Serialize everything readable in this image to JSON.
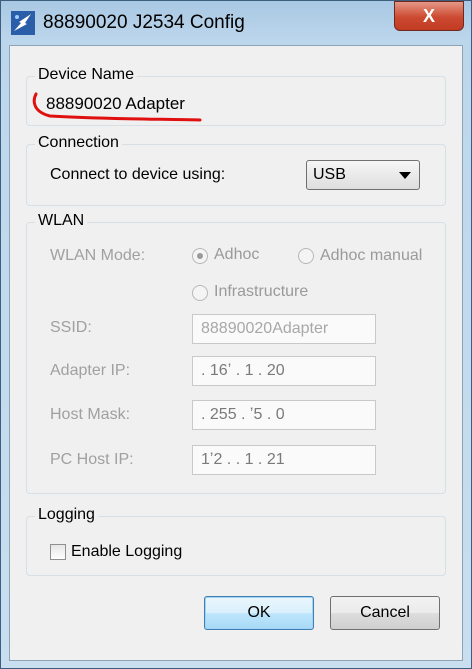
{
  "window": {
    "title": "88890020 J2534 Config",
    "close_symbol": "X"
  },
  "device_name": {
    "legend": "Device Name",
    "value": "88890020 Adapter"
  },
  "connection": {
    "legend": "Connection",
    "label": "Connect to device using:",
    "selected": "USB"
  },
  "wlan": {
    "legend": "WLAN",
    "mode_label": "WLAN Mode:",
    "modes": [
      "Adhoc",
      "Adhoc manual",
      "Infrastructure"
    ],
    "selected_mode": "Adhoc",
    "ssid_label": "SSID:",
    "ssid_value": "88890020Adapter",
    "adapter_ip_label": "Adapter IP:",
    "adapter_ip_value": "      .  16ʼ  .   1   .  20",
    "host_mask_label": "Host Mask:",
    "host_mask_value": "      .  255  .  ʼ5  .   0",
    "pc_host_ip_label": "PC Host IP:",
    "pc_host_ip_value": "1ʼ2  .        .   1   .  21"
  },
  "logging": {
    "legend": "Logging",
    "enable_label": "Enable Logging",
    "enabled": false
  },
  "buttons": {
    "ok": "OK",
    "cancel": "Cancel"
  },
  "colors": {
    "annotation": "#e01010",
    "accent": "#3c7fb1"
  }
}
